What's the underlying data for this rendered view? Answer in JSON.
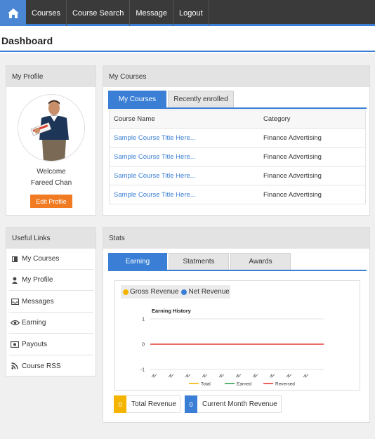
{
  "nav": {
    "home_icon": "home-icon",
    "items": [
      "Courses",
      "Course Search",
      "Message",
      "Logout"
    ]
  },
  "page": {
    "title": "Dashboard"
  },
  "profile": {
    "heading": "My Profile",
    "welcome": "Welcome",
    "name": "Fareed Chan",
    "edit_button": "Edit Profile"
  },
  "courses": {
    "heading": "My Courses",
    "tabs": [
      "My Courses",
      "Recently enrolled"
    ],
    "columns": [
      "Course Name",
      "Category"
    ],
    "rows": [
      {
        "name": "Sample Course Title Here...",
        "category": "Finance Advertising"
      },
      {
        "name": "Sample Course Title Here...",
        "category": "Finance Advertising"
      },
      {
        "name": "Sample Course Title Here...",
        "category": "Finance Advertising"
      },
      {
        "name": "Sample Course Title Here...",
        "category": "Finance Advertising"
      }
    ]
  },
  "links": {
    "heading": "Useful Links",
    "items": [
      {
        "label": "My Courses",
        "icon": "book-icon"
      },
      {
        "label": "My Profile",
        "icon": "user-icon"
      },
      {
        "label": "Messages",
        "icon": "inbox-icon"
      },
      {
        "label": "Earning",
        "icon": "eye-icon"
      },
      {
        "label": "Payouts",
        "icon": "money-icon"
      },
      {
        "label": "Course RSS",
        "icon": "rss-icon"
      }
    ]
  },
  "stats": {
    "heading": "Stats",
    "tabs": [
      "Earning",
      "Statments",
      "Awards"
    ],
    "legend": {
      "gross": "Gross Revenue",
      "net": "Net Revenue"
    },
    "total_revenue": {
      "value": "0",
      "label": "Total Revenue"
    },
    "month_revenue": {
      "value": "0",
      "label": "Current Month Revenue"
    }
  },
  "colors": {
    "accent": "#3a7fd5",
    "orange": "#f07b22",
    "gold": "#f5b400",
    "nav_bg": "#3a3a3a"
  },
  "chart_data": {
    "type": "line",
    "title": "Earning History",
    "y_ticks": [
      "1",
      "0",
      "-1"
    ],
    "ylim": [
      -1,
      1
    ],
    "x_tick_count": 10,
    "series": [
      {
        "name": "Total",
        "color": "#f5b400",
        "values": []
      },
      {
        "name": "Earned",
        "color": "#2e9e48",
        "values": []
      },
      {
        "name": "Reversed",
        "color": "#e53935",
        "values": [
          0,
          0,
          0,
          0,
          0,
          0,
          0,
          0,
          0,
          0
        ]
      }
    ]
  }
}
